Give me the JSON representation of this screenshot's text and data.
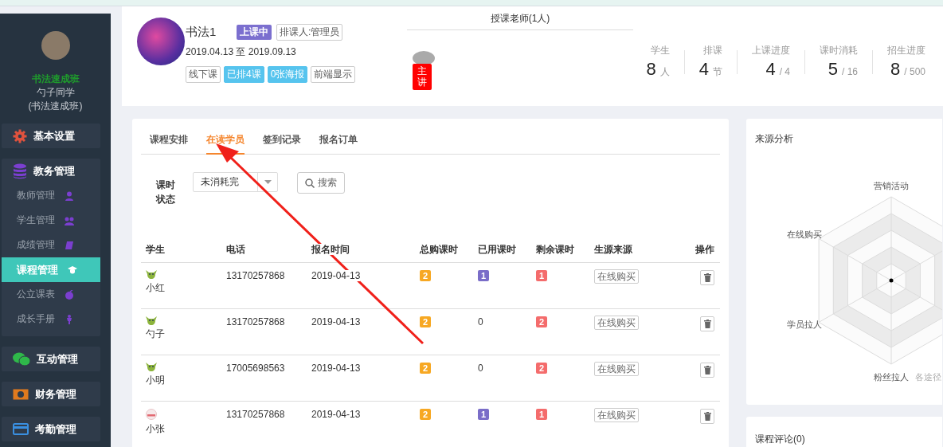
{
  "sidebar": {
    "class_name": "书法速成班",
    "student_name": "勺子同学",
    "class_label": "(书法速成班)",
    "menu": [
      {
        "label": "基本设置"
      },
      {
        "label": "教务管理",
        "children": [
          {
            "label": "教师管理",
            "selected": false
          },
          {
            "label": "学生管理",
            "selected": false
          },
          {
            "label": "成绩管理",
            "selected": false
          },
          {
            "label": "课程管理",
            "selected": true
          },
          {
            "label": "公立课表",
            "selected": false
          },
          {
            "label": "成长手册",
            "selected": false
          }
        ]
      },
      {
        "label": "互动管理"
      },
      {
        "label": "财务管理"
      },
      {
        "label": "考勤管理"
      }
    ]
  },
  "header": {
    "course_title": "书法1",
    "status_badge": "上课中",
    "scheduler": "排课人:管理员",
    "date_range": "2019.04.13 至 2019.09.13",
    "tags": [
      {
        "label": "线下课",
        "kind": "outline"
      },
      {
        "label": "已排4课",
        "kind": "filled"
      },
      {
        "label": "0张海报",
        "kind": "filled"
      },
      {
        "label": "前端显示",
        "kind": "outline"
      }
    ],
    "teachers_title": "授课老师(1人)",
    "teacher_role": "主讲",
    "stats": [
      {
        "label": "学生",
        "value": "8",
        "unit": "人"
      },
      {
        "label": "排课",
        "value": "4",
        "unit": "节"
      },
      {
        "label": "上课进度",
        "value": "4",
        "unit": "/ 4"
      },
      {
        "label": "课时消耗",
        "value": "5",
        "unit": "/ 16"
      },
      {
        "label": "招生进度",
        "value": "8",
        "unit": "/ 500"
      }
    ]
  },
  "tabs": [
    {
      "label": "课程安排",
      "selected": false
    },
    {
      "label": "在读学员",
      "selected": true
    },
    {
      "label": "签到记录",
      "selected": false
    },
    {
      "label": "报名订单",
      "selected": false
    }
  ],
  "filter": {
    "label": "课时状态",
    "value": "未消耗完",
    "search_button": "搜索"
  },
  "table": {
    "columns": [
      "学生",
      "电话",
      "报名时间",
      "总购课时",
      "已用课时",
      "剩余课时",
      "生源来源",
      "操作"
    ],
    "rows": [
      {
        "kind": "creature",
        "name": "小红",
        "phone": "13170257868",
        "date": "2019-04-13",
        "total": {
          "text": "2",
          "badge": true
        },
        "used": {
          "text": "1",
          "badge": true
        },
        "remaining": {
          "text": "1",
          "badge": true
        },
        "source": "在线购买"
      },
      {
        "kind": "creature",
        "name": "勺子",
        "phone": "13170257868",
        "date": "2019-04-13",
        "total": {
          "text": "2",
          "badge": true
        },
        "used": {
          "text": "0",
          "badge": false
        },
        "remaining": {
          "text": "2",
          "badge": true
        },
        "source": "在线购买"
      },
      {
        "kind": "creature",
        "name": "小明",
        "phone": "17005698563",
        "date": "2019-04-13",
        "total": {
          "text": "2",
          "badge": true
        },
        "used": {
          "text": "0",
          "badge": false
        },
        "remaining": {
          "text": "2",
          "badge": true
        },
        "source": "在线购买"
      },
      {
        "kind": "face",
        "name": "小张",
        "phone": "13170257868",
        "date": "2019-04-13",
        "total": {
          "text": "2",
          "badge": true
        },
        "used": {
          "text": "1",
          "badge": true
        },
        "remaining": {
          "text": "1",
          "badge": true
        },
        "source": "在线购买"
      }
    ]
  },
  "source_analysis": {
    "title": "来源分析",
    "axes": [
      "营销活动",
      "在线购买",
      "学员拉人",
      "粉丝拉人",
      "各途径"
    ]
  },
  "comments": {
    "title": "课程评论(0)"
  }
}
